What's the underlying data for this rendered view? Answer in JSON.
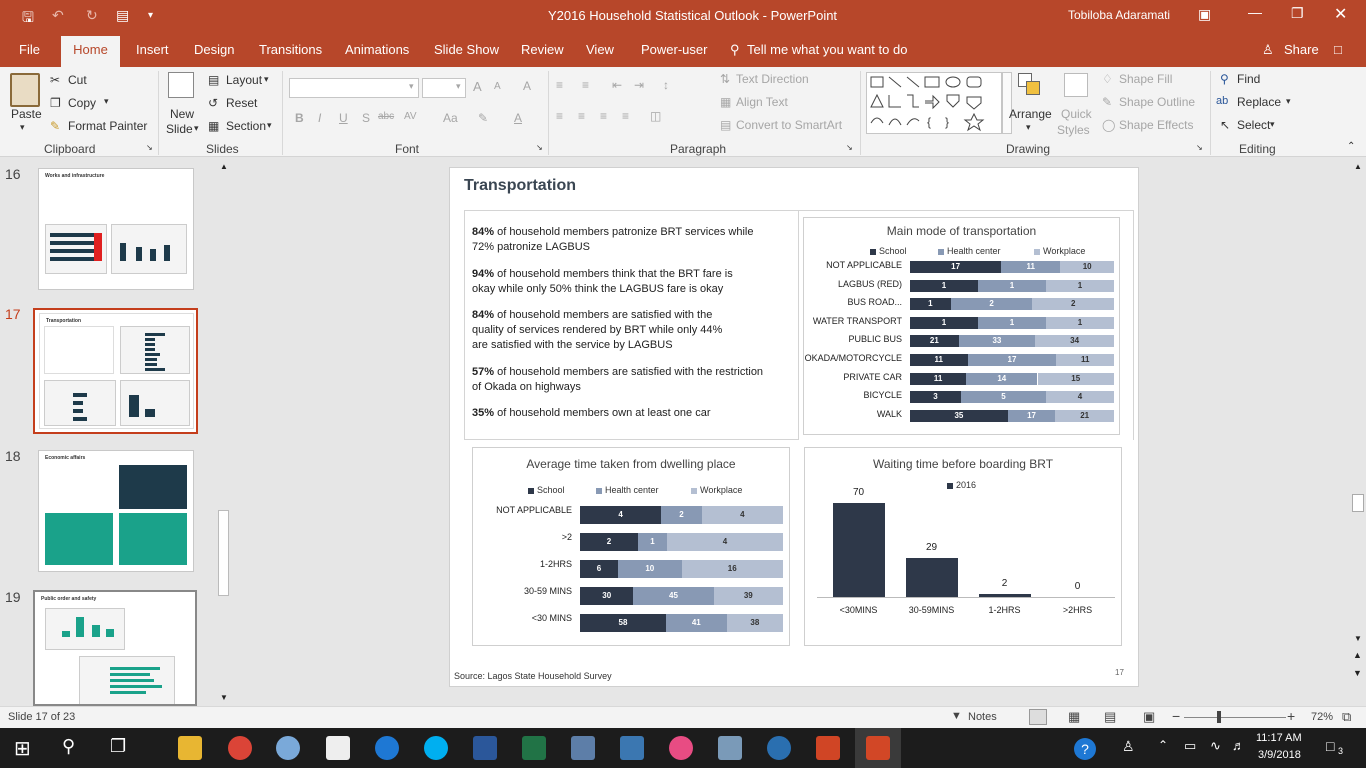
{
  "window": {
    "title": "Y2016 Household Statistical Outlook  -  PowerPoint",
    "user": "Tobiloba Adaramati"
  },
  "tabs": [
    "File",
    "Home",
    "Insert",
    "Design",
    "Transitions",
    "Animations",
    "Slide Show",
    "Review",
    "View",
    "Power-user"
  ],
  "tell_me": "Tell me what you want to do",
  "share": "Share",
  "ribbon": {
    "clipboard": {
      "paste": "Paste",
      "cut": "Cut",
      "copy": "Copy",
      "format_painter": "Format Painter",
      "label": "Clipboard"
    },
    "slides": {
      "new_slide": "New",
      "new_slide2": "Slide",
      "layout": "Layout",
      "reset": "Reset",
      "section": "Section",
      "label": "Slides"
    },
    "font": {
      "label": "Font",
      "bold": "B",
      "italic": "I",
      "underline": "U",
      "shadow": "S",
      "strike": "abc",
      "spacing": "AV",
      "grow": "A",
      "shrink": "A",
      "clear": "A",
      "color": "A"
    },
    "paragraph": {
      "label": "Paragraph",
      "text_direction": "Text Direction",
      "align_text": "Align Text",
      "convert": "Convert to SmartArt"
    },
    "drawing": {
      "label": "Drawing",
      "arrange": "Arrange",
      "quick_styles": "Quick",
      "quick_styles2": "Styles",
      "shape_fill": "Shape Fill",
      "shape_outline": "Shape Outline",
      "shape_effects": "Shape Effects"
    },
    "editing": {
      "label": "Editing",
      "find": "Find",
      "replace": "Replace",
      "select": "Select"
    }
  },
  "thumbnails": [
    {
      "num": "16",
      "title": "Works and infrastructure"
    },
    {
      "num": "17",
      "title": "Transportation"
    },
    {
      "num": "18",
      "title": "Economic affairs"
    },
    {
      "num": "19",
      "title": "Public order and safety"
    }
  ],
  "slide": {
    "title": "Transportation",
    "stats": [
      {
        "pct": "84%",
        "text": " of household members patronize BRT services while",
        "text2": "72% patronize LAGBUS"
      },
      {
        "pct": "94%",
        "text": " of household members think that the BRT fare is",
        "text2": "okay while only 50% think the LAGBUS fare is okay"
      },
      {
        "pct": "84%",
        "text": " of household members are satisfied with the",
        "text2": "quality of services rendered by BRT while only 44%",
        "text3": "are satisfied with the service by LAGBUS"
      },
      {
        "pct": "57%",
        "text": " of household members are satisfied with the restriction",
        "text2": "of Okada on highways"
      },
      {
        "pct": "35%",
        "text": " of household members own at least one car"
      }
    ],
    "source": "Source:  Lagos State Household Survey",
    "number": "17"
  },
  "chart_data": [
    {
      "type": "bar",
      "orientation": "horizontal-stacked",
      "title": "Main mode of transportation",
      "categories": [
        "NOT APPLICABLE",
        "LAGBUS (RED)",
        "BUS ROAD...",
        "WATER TRANSPORT",
        "PUBLIC BUS",
        "OKADA/MOTORCYCLE",
        "PRIVATE CAR",
        "BICYCLE",
        "WALK"
      ],
      "series": [
        {
          "name": "School",
          "values": [
            17,
            1,
            1,
            1,
            21,
            11,
            11,
            3,
            35
          ],
          "color": "#2e3849"
        },
        {
          "name": "Health center",
          "values": [
            11,
            1,
            2,
            1,
            33,
            17,
            14,
            5,
            17
          ],
          "color": "#8899b4"
        },
        {
          "name": "Workplace",
          "values": [
            10,
            1,
            2,
            1,
            34,
            11,
            15,
            4,
            21
          ],
          "color": "#b4bfd2"
        }
      ],
      "legend": "top"
    },
    {
      "type": "bar",
      "orientation": "horizontal-stacked",
      "title": "Average time taken from dwelling place",
      "categories": [
        "NOT APPLICABLE",
        ">2",
        "1-2HRS",
        "30-59 MINS",
        "<30 MINS"
      ],
      "series": [
        {
          "name": "School",
          "values": [
            4,
            2,
            6,
            30,
            58
          ],
          "color": "#2e3849"
        },
        {
          "name": "Health center",
          "values": [
            2,
            1,
            10,
            45,
            41
          ],
          "color": "#8899b4"
        },
        {
          "name": "Workplace",
          "values": [
            4,
            4,
            16,
            39,
            38
          ],
          "color": "#b4bfd2"
        }
      ],
      "legend": "top"
    },
    {
      "type": "bar",
      "title": "Waiting time before boarding BRT",
      "categories": [
        "<30MINS",
        "30-59MINS",
        "1-2HRS",
        ">2HRS"
      ],
      "series": [
        {
          "name": "2016",
          "values": [
            70,
            29,
            2,
            0
          ],
          "color": "#2e3849"
        }
      ],
      "ylim": [
        0,
        80
      ],
      "legend": "top"
    }
  ],
  "status": {
    "slide_of": "Slide 17 of 23",
    "notes": "Notes",
    "zoom": "72%"
  },
  "taskbar": {
    "time": "11:17 AM",
    "date": "3/9/2018",
    "notif": "3"
  }
}
